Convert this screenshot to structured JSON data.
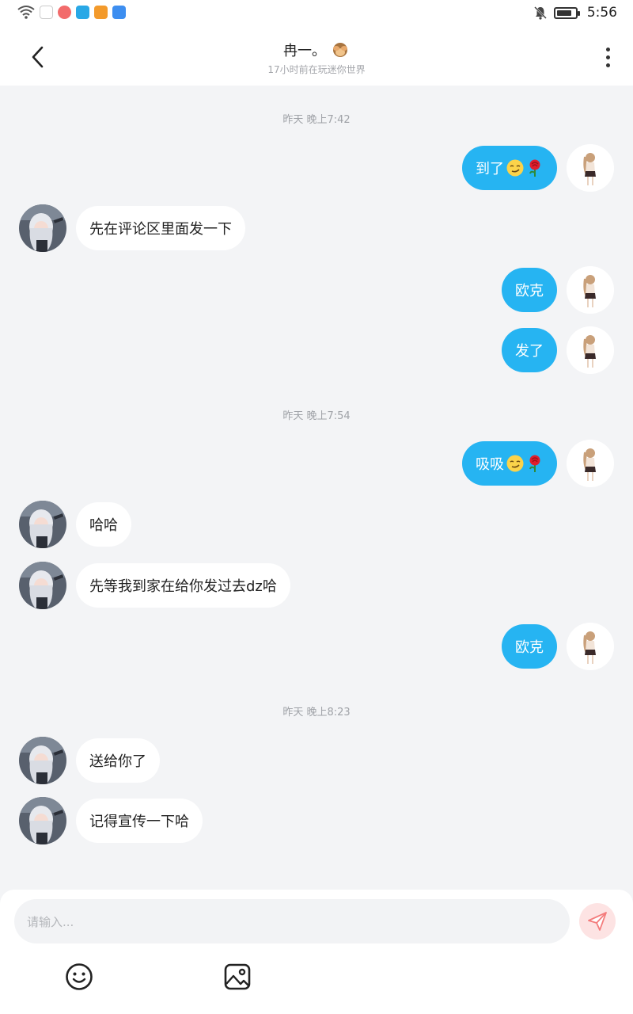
{
  "status_bar": {
    "time": "5:56"
  },
  "header": {
    "back_icon": "chevron-left-icon",
    "title": "冉一。",
    "title_emoji": "see-no-evil-monkey-icon",
    "subtitle": "17小时前在玩迷你世界",
    "more_icon": "more-vertical-icon"
  },
  "messages": [
    {
      "kind": "time",
      "text": "昨天 晚上7:42"
    },
    {
      "kind": "msg",
      "side": "right",
      "text": "到了",
      "emojis": [
        "smirk-face-icon",
        "rose-icon"
      ]
    },
    {
      "kind": "msg",
      "side": "left",
      "text": "先在评论区里面发一下"
    },
    {
      "kind": "msg",
      "side": "right",
      "text": "欧克"
    },
    {
      "kind": "msg",
      "side": "right",
      "text": "发了"
    },
    {
      "kind": "time",
      "text": "昨天 晚上7:54"
    },
    {
      "kind": "msg",
      "side": "right",
      "text": "吸吸",
      "emojis": [
        "smirk-face-icon",
        "rose-icon"
      ]
    },
    {
      "kind": "msg",
      "side": "left",
      "text": "哈哈"
    },
    {
      "kind": "msg",
      "side": "left",
      "text": "先等我到家在给你发过去dz哈"
    },
    {
      "kind": "msg",
      "side": "right",
      "text": "欧克"
    },
    {
      "kind": "time",
      "text": "昨天 晚上8:23"
    },
    {
      "kind": "msg",
      "side": "left",
      "text": "送给你了"
    },
    {
      "kind": "msg",
      "side": "left",
      "text": "记得宣传一下哈"
    }
  ],
  "input": {
    "placeholder": "请输入...",
    "send_icon": "send-icon",
    "emoji_tool_icon": "emoji-icon",
    "image_tool_icon": "image-icon"
  },
  "colors": {
    "accent_bubble": "#26b4f2",
    "background": "#f3f4f6",
    "send_button_bg": "#fde3e3",
    "send_button_fg": "#f47c7c"
  }
}
